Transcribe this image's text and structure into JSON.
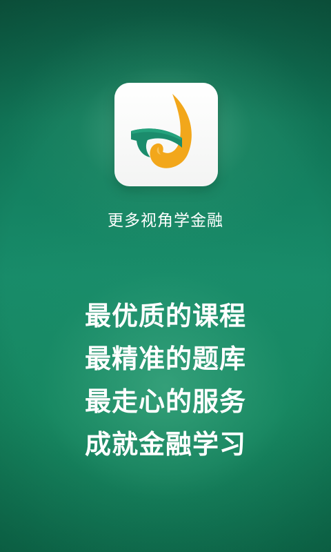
{
  "app": {
    "logo_icon": "swirl-leaf-logo-icon",
    "colors": {
      "background_top": "#0e5a43",
      "background_mid": "#178b69",
      "logo_teal": "#1b8c6c",
      "logo_orange": "#f2a71b",
      "text": "#ffffff"
    }
  },
  "tagline": "更多视角学金融",
  "slogans": [
    "最优质的课程",
    "最精准的题库",
    "最走心的服务",
    "成就金融学习"
  ]
}
